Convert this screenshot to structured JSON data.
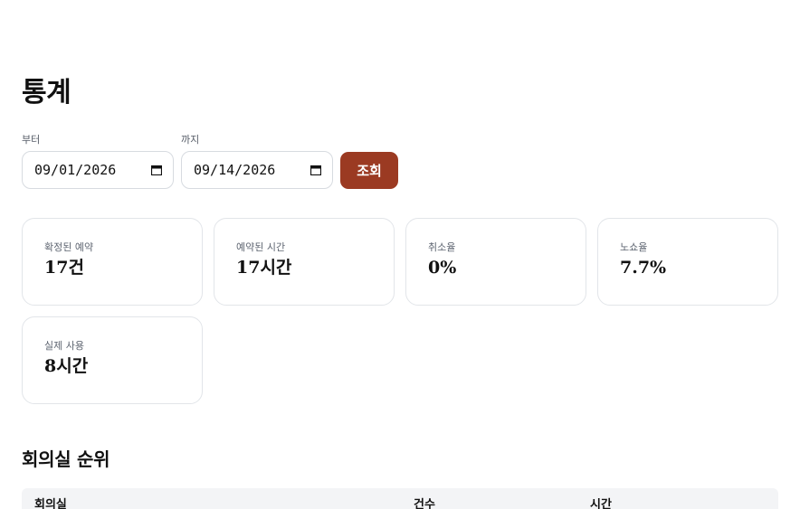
{
  "page": {
    "title": "통계"
  },
  "filters": {
    "from_label": "부터",
    "from_value": "09/01/2026",
    "to_label": "까지",
    "to_value": "09/14/2026",
    "query_label": "조회",
    "calendar_icon": "calendar-icon"
  },
  "stats": [
    {
      "label": "확정된 예약",
      "value": "17건"
    },
    {
      "label": "예약된 시간",
      "value": "17시간"
    },
    {
      "label": "취소율",
      "value": "0%"
    },
    {
      "label": "노쇼율",
      "value": "7.7%"
    },
    {
      "label": "실제 사용",
      "value": "8시간"
    }
  ],
  "ranking": {
    "title": "회의실 순위",
    "columns": [
      "회의실",
      "건수",
      "시간"
    ]
  },
  "colors": {
    "accent": "#9b3a22",
    "card_border": "#e2e5e9",
    "table_header_bg": "#f3f4f6"
  }
}
